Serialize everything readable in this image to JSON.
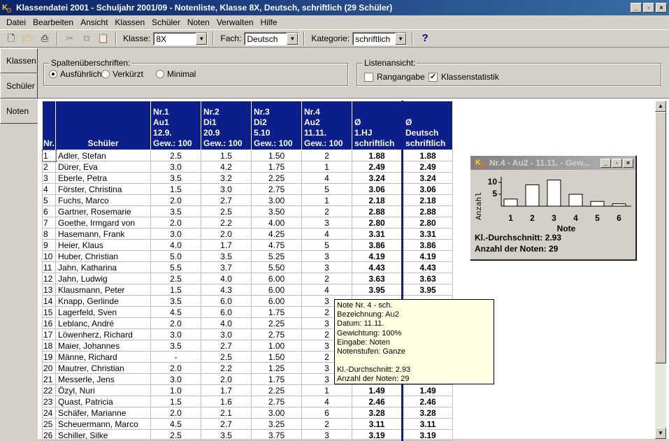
{
  "window": {
    "title": "Klassendatei 2001 - Schuljahr 2001/09 - Notenliste, Klasse 8X, Deutsch, schriftlich (29 Schüler)",
    "logo_main": "K",
    "logo_sub": "D",
    "controls": [
      "_",
      "▫",
      "×"
    ]
  },
  "menu": [
    "Datei",
    "Bearbeiten",
    "Ansicht",
    "Klassen",
    "Schüler",
    "Noten",
    "Verwalten",
    "Hilfe"
  ],
  "toolbar": {
    "klasse_label": "Klasse:",
    "klasse_value": "8X",
    "fach_label": "Fach:",
    "fach_value": "Deutsch",
    "kategorie_label": "Kategorie:",
    "kategorie_value": "schriftlich",
    "icons": [
      "new-icon",
      "open-icon",
      "print-icon",
      "cut-icon",
      "copy-icon",
      "paste-icon",
      "help-icon"
    ]
  },
  "left_tabs": [
    "Klassen",
    "Schüler",
    "Noten"
  ],
  "spalten": {
    "title": "Spaltenüberschriften:",
    "options": [
      "Ausführlich",
      "Verkürzt",
      "Minimal"
    ],
    "selected": "Ausführlich"
  },
  "liste": {
    "title": "Listenansicht:",
    "rangangabe": "Rangangabe",
    "rangangabe_checked": false,
    "klassenstatistik": "Klassenstatistik",
    "klassenstatistik_checked": true
  },
  "table": {
    "headers": {
      "nr": "Nr.",
      "name": "Schüler",
      "col1": [
        "Nr.1",
        "Au1",
        "12.9.",
        "Gew.: 100"
      ],
      "col2": [
        "Nr.2",
        "Di1",
        "20.9",
        "Gew.: 100"
      ],
      "col3": [
        "Nr.3",
        "Di2",
        "5.10",
        "Gew.: 100"
      ],
      "col4": [
        "Nr.4",
        "Au2",
        "11.11.",
        "Gew.: 100"
      ],
      "col5": [
        "Ø",
        "1.HJ",
        "schriftlich"
      ],
      "col6": [
        "Ø",
        "Deutsch",
        "schriftlich"
      ]
    },
    "rows": [
      [
        "1",
        "Adler, Stefan",
        "2.5",
        "1.5",
        "1.50",
        "2",
        "1.88",
        "1.88"
      ],
      [
        "2",
        "Dürer, Eva",
        "3.0",
        "4.2",
        "1.75",
        "1",
        "2.49",
        "2.49"
      ],
      [
        "3",
        "Eberle, Petra",
        "3.5",
        "3.2",
        "2.25",
        "4",
        "3.24",
        "3.24"
      ],
      [
        "4",
        "Förster, Christina",
        "1.5",
        "3.0",
        "2.75",
        "5",
        "3.06",
        "3.06"
      ],
      [
        "5",
        "Fuchs, Marco",
        "2.0",
        "2.7",
        "3.00",
        "1",
        "2.18",
        "2.18"
      ],
      [
        "6",
        "Gartner, Rosemarie",
        "3.5",
        "2.5",
        "3.50",
        "2",
        "2.88",
        "2.88"
      ],
      [
        "7",
        "Goethe, Irmgard von",
        "2.0",
        "2.2",
        "4.00",
        "3",
        "2.80",
        "2.80"
      ],
      [
        "8",
        "Hasemann, Frank",
        "3.0",
        "2.0",
        "4.25",
        "4",
        "3.31",
        "3.31"
      ],
      [
        "9",
        "Heier, Klaus",
        "4.0",
        "1.7",
        "4.75",
        "5",
        "3.86",
        "3.86"
      ],
      [
        "10",
        "Huber, Christian",
        "5.0",
        "3.5",
        "5.25",
        "3",
        "4.19",
        "4.19"
      ],
      [
        "11",
        "Jahn, Katharina",
        "5.5",
        "3.7",
        "5.50",
        "3",
        "4.43",
        "4.43"
      ],
      [
        "12",
        "Jahn, Ludwig",
        "2.5",
        "4.0",
        "6.00",
        "2",
        "3.63",
        "3.63"
      ],
      [
        "13",
        "Klausmann, Peter",
        "1.5",
        "4.3",
        "6.00",
        "4",
        "3.95",
        "3.95"
      ],
      [
        "14",
        "Knapp, Gerlinde",
        "3.5",
        "6.0",
        "6.00",
        "3",
        "",
        ""
      ],
      [
        "15",
        "Lagerfeld, Sven",
        "4.5",
        "6.0",
        "1.75",
        "2",
        "",
        ""
      ],
      [
        "16",
        "Leblanc, André",
        "2.0",
        "4.0",
        "2.25",
        "3",
        "",
        ""
      ],
      [
        "17",
        "Löwenherz, Richard",
        "3.0",
        "3.0",
        "2.75",
        "2",
        "",
        ""
      ],
      [
        "18",
        "Maier, Johannes",
        "3.5",
        "2.7",
        "1.00",
        "3",
        "",
        ""
      ],
      [
        "19",
        "Männe, Richard",
        "-",
        "2.5",
        "1.50",
        "2",
        "",
        ""
      ],
      [
        "20",
        "Mautrer, Christian",
        "2.0",
        "2.2",
        "1.25",
        "3",
        "",
        ""
      ],
      [
        "21",
        "Messerle, Jens",
        "3.0",
        "2.0",
        "1.75",
        "3",
        "",
        ""
      ],
      [
        "22",
        "Özyl, Nuri",
        "1.0",
        "1.7",
        "2.25",
        "1",
        "1.49",
        "1.49"
      ],
      [
        "23",
        "Quast, Patricia",
        "1.5",
        "1.6",
        "2.75",
        "4",
        "2.46",
        "2.46"
      ],
      [
        "24",
        "Schäfer, Marianne",
        "2.0",
        "2.1",
        "3.00",
        "6",
        "3.28",
        "3.28"
      ],
      [
        "25",
        "Scheuermann, Marco",
        "4.5",
        "2.7",
        "3.25",
        "2",
        "3.11",
        "3.11"
      ],
      [
        "26",
        "Schiller, Silke",
        "2.5",
        "3.5",
        "3.75",
        "3",
        "3.19",
        "3.19"
      ]
    ]
  },
  "mini": {
    "title": "Nr.4 - Au2 - 11.11. - Gew...",
    "ylabel": "Anzahl",
    "xlabel": "Note",
    "yticks": [
      "10",
      "5"
    ],
    "categories": [
      "1",
      "2",
      "3",
      "4",
      "5",
      "6"
    ],
    "values": [
      3,
      9,
      11,
      5,
      2,
      1
    ],
    "durchschnitt": "Kl.-Durchschnitt: 2.93",
    "anzahl": "Anzahl der Noten: 29"
  },
  "tooltip": {
    "lines": [
      "Note Nr. 4 - sch.",
      "Bezeichnung: Au2",
      "Datum: 11.11.",
      "Gewichtung: 100%",
      "Eingabe: Noten",
      "Notenstufen: Ganze",
      "",
      "Kl.-Durchschnitt: 2.93",
      "Anzahl der Noten: 29"
    ]
  },
  "colors": {
    "header_bg": "#0a1e8c",
    "titlebar": "#0a246a",
    "tooltip_bg": "#ffffe1"
  }
}
